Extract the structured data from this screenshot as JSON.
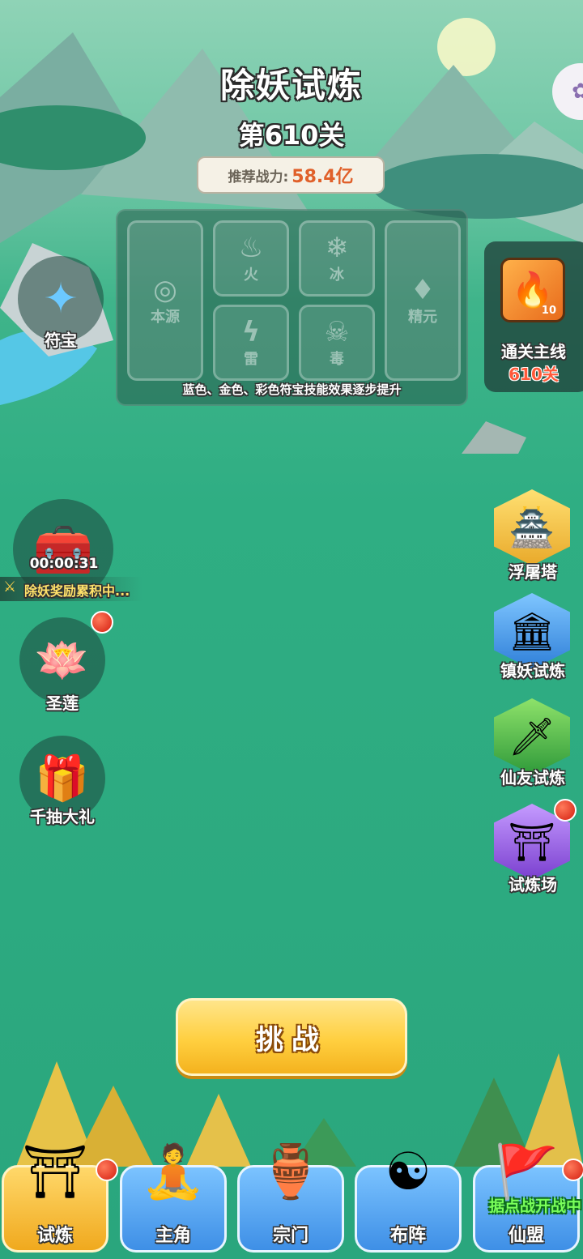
{
  "header": {
    "title": "除妖试炼",
    "level": "第610关",
    "power_label": "推荐战力:",
    "power_value": "58.4亿"
  },
  "skills_panel": {
    "slots": [
      {
        "label": "本源",
        "icon": "swirl-icon"
      },
      {
        "label": "火",
        "icon": "fire-icon"
      },
      {
        "label": "冰",
        "icon": "snowflake-icon"
      },
      {
        "label": "精元",
        "icon": "essence-flame-icon"
      },
      {
        "label": "雷",
        "icon": "lightning-icon"
      },
      {
        "label": "毒",
        "icon": "poison-skull-icon"
      }
    ],
    "note": "蓝色、金色、彩色符宝技能效果逐步提升"
  },
  "left_buttons": {
    "talisman": "符宝",
    "chest_timer": "00:00:31",
    "reward_text": "除妖奖励累积中...",
    "holy_lotus": "圣莲",
    "gift": "千抽大礼"
  },
  "mainline": {
    "label": "通关主线",
    "level": "610关",
    "badge": "10"
  },
  "right_buttons": [
    {
      "label": "浮屠塔",
      "icon": "pagoda-icon"
    },
    {
      "label": "镇妖试炼",
      "icon": "blue-pagoda-icon"
    },
    {
      "label": "仙友试炼",
      "icon": "sword-icon"
    },
    {
      "label": "试炼场",
      "icon": "arena-gate-icon"
    }
  ],
  "challenge_button": "挑战",
  "bottom_nav": {
    "items": [
      {
        "label": "试炼",
        "icon": "shrine-icon"
      },
      {
        "label": "主角",
        "icon": "hero-icon"
      },
      {
        "label": "宗门",
        "icon": "cauldron-icon"
      },
      {
        "label": "布阵",
        "icon": "yin-yang-icon"
      },
      {
        "label": "仙盟",
        "icon": "banner-icon"
      }
    ],
    "alliance_note": "据点战开战中"
  }
}
